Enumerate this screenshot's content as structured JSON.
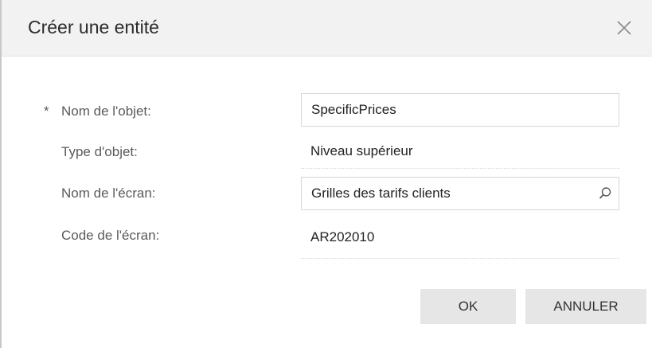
{
  "dialog": {
    "title": "Créer une entité",
    "close_icon": "close-icon"
  },
  "form": {
    "object_name": {
      "required_marker": "*",
      "label": "Nom de l'objet:",
      "value": "SpecificPrices"
    },
    "object_type": {
      "label": "Type d'objet:",
      "value": "Niveau supérieur"
    },
    "screen_name": {
      "label": "Nom de l'écran:",
      "value": "Grilles des tarifs clients",
      "icon": "search-icon"
    },
    "screen_code": {
      "label": "Code de l'écran:",
      "value": "AR202010"
    }
  },
  "buttons": {
    "ok": "OK",
    "cancel": "ANNULER"
  }
}
